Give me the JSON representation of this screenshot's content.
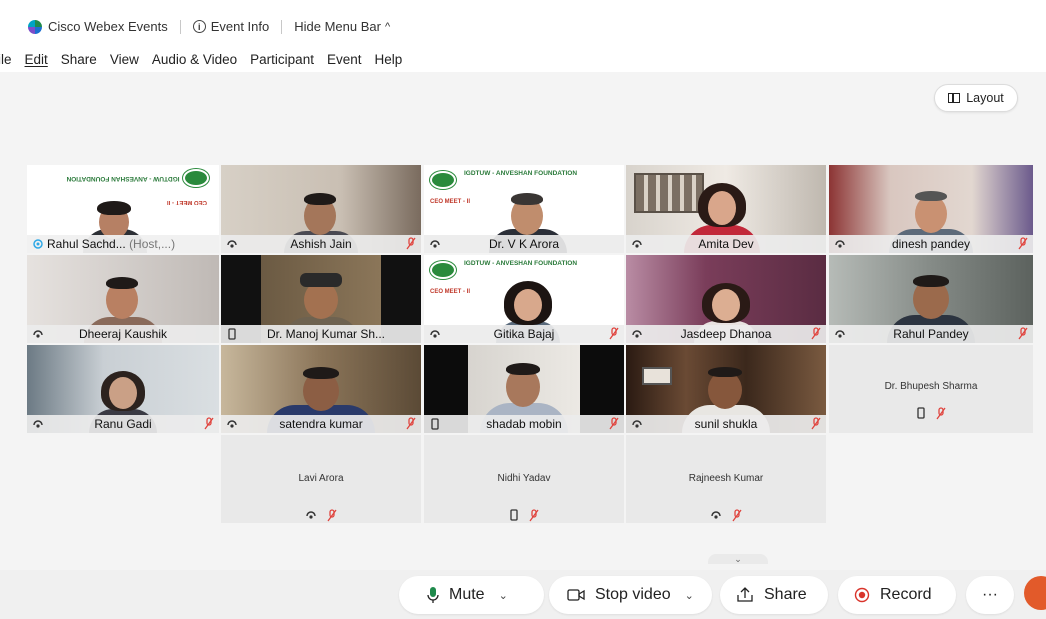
{
  "titlebar": {
    "app_name": "Cisco Webex Events",
    "event_info": "Event Info",
    "hide_menu_bar": "Hide Menu Bar"
  },
  "menu": [
    "File",
    "Edit",
    "Share",
    "View",
    "Audio & Video",
    "Participant",
    "Event",
    "Help"
  ],
  "menu_display": [
    "ile",
    "Edit",
    "Share",
    "View",
    "Audio & Video",
    "Participant",
    "Event",
    "Help"
  ],
  "layout_button": "Layout",
  "banner": {
    "org": "IGDTUW - ANVESHAN FOUNDATION",
    "ceo_meet": "CEO MEET - II"
  },
  "participants": [
    {
      "name": "Rahul Sachd...",
      "suffix": "(Host,...)"
    },
    {
      "name": "Ashish Jain"
    },
    {
      "name": "Dr. V K Arora"
    },
    {
      "name": "Amita Dev"
    },
    {
      "name": "dinesh pandey"
    },
    {
      "name": "Dheeraj Kaushik"
    },
    {
      "name": "Dr. Manoj Kumar Sh..."
    },
    {
      "name": "Gitika Bajaj"
    },
    {
      "name": "Jasdeep Dhanoa"
    },
    {
      "name": "Rahul Pandey"
    },
    {
      "name": "Ranu Gadi"
    },
    {
      "name": "satendra kumar"
    },
    {
      "name": "shadab mobin"
    },
    {
      "name": "sunil shukla"
    },
    {
      "name": "Dr. Bhupesh Sharma"
    },
    {
      "name": "Lavi Arora"
    },
    {
      "name": "Nidhi Yadav"
    },
    {
      "name": "Rajneesh Kumar"
    }
  ],
  "toolbar": {
    "mute": "Mute",
    "stop_video": "Stop video",
    "share": "Share",
    "record": "Record",
    "more": "···"
  },
  "colors": {
    "accent_border": "#2ea8e6",
    "mute_red": "#e0443e",
    "record_red": "#d9342b"
  }
}
